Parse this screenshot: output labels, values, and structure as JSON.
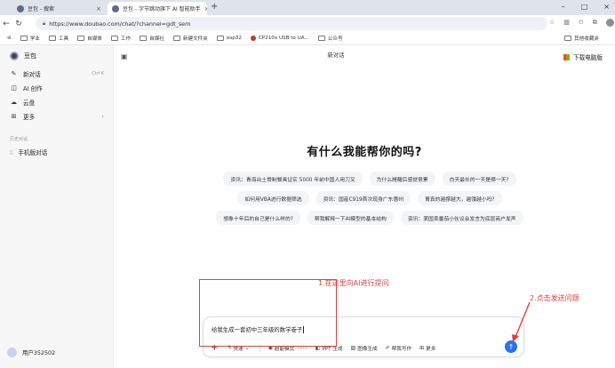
{
  "browser": {
    "tabs": [
      {
        "label": "豆包 - 搜索",
        "close": "×"
      },
      {
        "label": "豆包 - 字节跳动旗下 AI 智能助手",
        "close": "×"
      }
    ],
    "new_tab": "+",
    "window_controls": [
      "–",
      "□",
      "×"
    ],
    "url": "https://www.doubao.com/chat/?channel=gdt_sem",
    "bookmarks": [
      "学业",
      "工具",
      "自媒体",
      "工作",
      "自媒社",
      "新建文件夹",
      "esp32",
      "CP210x USB to UA...",
      "公众号"
    ],
    "bookmarks_right": "其他收藏夹"
  },
  "sidebar": {
    "app_name": "豆包",
    "items": [
      {
        "label": "新对话",
        "shortcut": "Ctrl K",
        "icon": "new-chat-icon"
      },
      {
        "label": "AI 创作",
        "icon": "ai-create-icon"
      },
      {
        "label": "云盘",
        "icon": "cloud-icon"
      },
      {
        "label": "更多",
        "icon": "grid-icon"
      }
    ],
    "history_label": "历史对话",
    "history": [
      "手机版对话"
    ],
    "user": "用户352502"
  },
  "main": {
    "topic_title": "新对话",
    "topic_sub": "",
    "download_label": "下载电脑版",
    "hero": "有什么我能帮你的吗?",
    "chips": [
      [
        "资讯：青海出土骨制餐具证实 5000 年前中国人用刀叉",
        "为什么睡醒后感觉很累",
        "白天最长的一天是哪一天?"
      ],
      [
        "如何用VBA进行数据筛选",
        "资讯：国産C919首次现身广东惠州",
        "胃真的越撑越大，越饿越小吗?"
      ],
      [
        "想象十年后的自己是什么样的?",
        "帮我解释一下AI模型的基本结构",
        "资讯：美国卖番茄小伙议会发言为底层商户发声"
      ]
    ]
  },
  "composer": {
    "text": "给我生成一套初中三年级的数学卷子",
    "tools": [
      {
        "label": "快速",
        "icon": "bolt-icon",
        "has_menu": true
      },
      {
        "label": "超能模式",
        "sub": "Beta",
        "icon": "super-icon"
      },
      {
        "label": "PPT 生成",
        "icon": "ppt-icon"
      },
      {
        "label": "图像生成",
        "icon": "image-icon"
      },
      {
        "label": "帮我写作",
        "icon": "write-icon"
      },
      {
        "label": "更多",
        "icon": "grid-icon"
      }
    ]
  },
  "annotations": {
    "step1": "1.在这里向AI进行提问",
    "step2": "2.点击发送问题",
    "color": "#e0413a"
  },
  "colors": {
    "accent": "#2d6ff2",
    "sidebar_bg": "#f7f7f8",
    "chip_bg": "#f3f4f6"
  }
}
